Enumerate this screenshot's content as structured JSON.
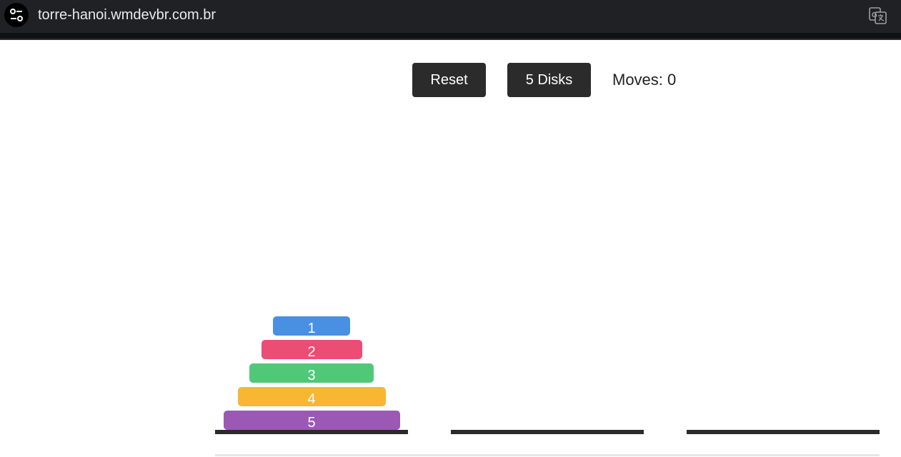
{
  "browser": {
    "url": "torre-hanoi.wmdevbr.com.br",
    "site_info_icon": "tune-icon",
    "translate_icon": "translate-icon"
  },
  "controls": {
    "reset_label": "Reset",
    "disks_label": "5 Disks",
    "moves_text": "Moves: 0"
  },
  "towers": [
    {
      "disks": [
        {
          "label": "1",
          "color": "#4a90e2"
        },
        {
          "label": "2",
          "color": "#eb4d75"
        },
        {
          "label": "3",
          "color": "#50c878"
        },
        {
          "label": "4",
          "color": "#f7b733"
        },
        {
          "label": "5",
          "color": "#9b59b6"
        }
      ]
    },
    {
      "disks": []
    },
    {
      "disks": []
    }
  ]
}
